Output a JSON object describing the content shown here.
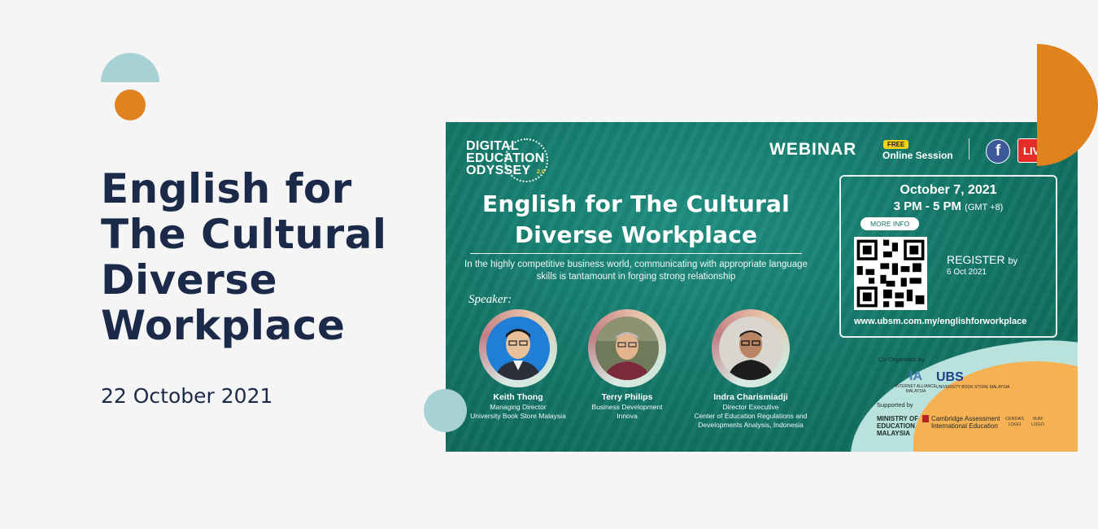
{
  "page": {
    "title": "English for The Cultural Diverse Workplace",
    "date": "22 October 2021"
  },
  "poster": {
    "logo": [
      "DIGITAL",
      "EDUCATION",
      "ODYSSEY"
    ],
    "logo_version": "2.0",
    "webinar": "WEBINAR",
    "free_badge": "FREE",
    "online_session": "Online Session",
    "facebook_glyph": "f",
    "live_label": "LIV",
    "title_line1": "English for The Cultural",
    "title_line2": "Diverse Workplace",
    "description": "In the highly competitive business world, communicating with appropriate language skills is tantamount in forging strong relationship",
    "speaker_label": "Speaker:",
    "speakers": [
      {
        "name": "Keith Thong",
        "role1": "Managing Director",
        "role2": "University Book Store Malaysia",
        "role3": ""
      },
      {
        "name": "Terry Philips",
        "role1": "Business Development",
        "role2": "Innova",
        "role3": ""
      },
      {
        "name": "Indra Charismiadji",
        "role1": "Director Executive",
        "role2": "Center of Education Regulations and",
        "role3": "Developments Analysis, Indonesia"
      }
    ],
    "event_date": "October 7, 2021",
    "event_time": "3 PM - 5 PM",
    "event_tz": "(GMT +8)",
    "more_info": "MORE INFO",
    "register": "REGISTER",
    "register_by": "by",
    "register_date": "6 Oct 2021",
    "url": "www.ubsm.com.my/englishforworkplace",
    "co_organised": "Co-Organised by",
    "supported": "Supported by",
    "logo_ia": "IA",
    "logo_ia_sub": "INTERNET ALLIANCE MALAYSIA",
    "logo_ubs": "UBS",
    "logo_ubs_sub": "UNIVERSITY BOOK STORE MALAYSIA",
    "moe_line1": "MINISTRY OF",
    "moe_line2": "EDUCATION",
    "moe_line3": "MALAYSIA",
    "cambridge_line1": "Cambridge Assessment",
    "cambridge_line2": "International Education",
    "cerdas_line1": "CERDAS",
    "cerdas_line2": "LOGO",
    "ium_line1": "IIUM",
    "ium_line2": "LOGO"
  },
  "colors": {
    "navy": "#1c2a4a",
    "orange": "#e0831f",
    "teal_light": "#a8d1d6",
    "poster_green": "#137566"
  }
}
